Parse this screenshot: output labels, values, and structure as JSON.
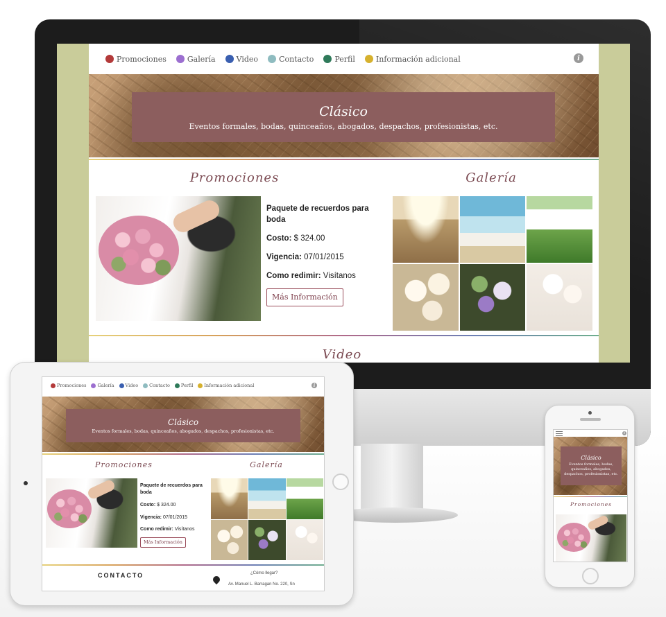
{
  "nav": {
    "items": [
      {
        "label": "Promociones",
        "color": "#b33a3a",
        "icon": "gift-icon"
      },
      {
        "label": "Galería",
        "color": "#9c6fd0",
        "icon": "gallery-icon"
      },
      {
        "label": "Video",
        "color": "#3a5fb0",
        "icon": "video-icon"
      },
      {
        "label": "Contacto",
        "color": "#8fbcc0",
        "icon": "contact-icon"
      },
      {
        "label": "Perfil",
        "color": "#2f7a5a",
        "icon": "profile-icon"
      },
      {
        "label": "Información adicional",
        "color": "#d6b12e",
        "icon": "info-icon"
      }
    ],
    "info_glyph": "i"
  },
  "hero": {
    "title": "Clásico",
    "subtitle": "Eventos formales, bodas, quinceaños, abogados, despachos, profesionistas, etc."
  },
  "promo": {
    "heading": "Promociones",
    "title": "Paquete de recuerdos para boda",
    "cost_label": "Costo:",
    "cost_value": "$ 324.00",
    "validity_label": "Vigencia:",
    "validity_value": "07/01/2015",
    "redeem_label": "Como redimir:",
    "redeem_value": "Visítanos",
    "button": "Más Información"
  },
  "gallery": {
    "heading": "Galería"
  },
  "video": {
    "heading": "Video"
  },
  "contact": {
    "heading": "CONTACTO",
    "question": "¿Cómo llegar?",
    "address": "Av. Manuel L. Barragan No. 220, Sn"
  },
  "theme": {
    "accent": "#8c5e5e",
    "frame": "#c9cc9a"
  }
}
